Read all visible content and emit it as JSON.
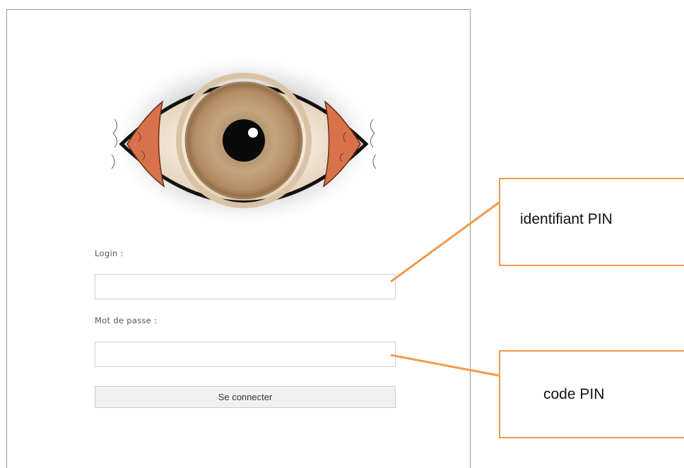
{
  "login_form": {
    "login_label": "Login :",
    "login_value": "",
    "password_label": "Mot de passe :",
    "password_value": "",
    "submit_label": "Se connecter"
  },
  "annotations": {
    "identifier_callout": "identifiant PIN",
    "code_callout": "code PIN"
  },
  "logo": {
    "icon": "eye-icon"
  },
  "colors": {
    "callout_orange": "#f29a4d",
    "iris": "#b8936b",
    "sclera_red": "#d9714a",
    "button_bg": "#f1f1f1"
  }
}
